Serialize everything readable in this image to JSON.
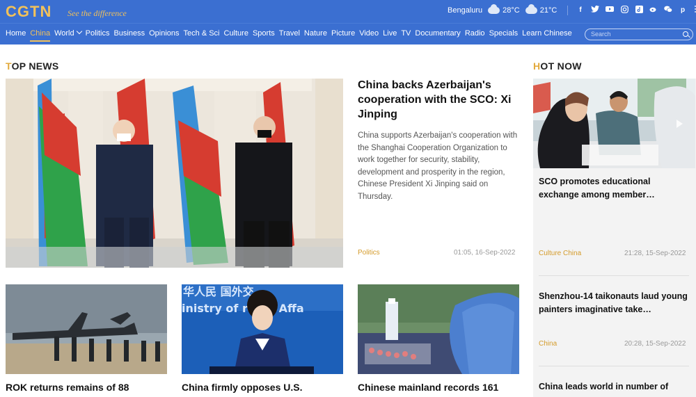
{
  "header": {
    "logo": "CGTN",
    "slogan": "See the difference",
    "city": "Bengaluru",
    "temp_high": "28°C",
    "temp_low": "21°C",
    "social_icons": [
      "facebook-icon",
      "twitter-icon",
      "youtube-icon",
      "instagram-icon",
      "tiktok-icon",
      "weibo-icon",
      "wechat-icon",
      "pinterest-icon",
      "more-icon"
    ]
  },
  "nav": {
    "items": [
      "Home",
      "China",
      "World",
      "Politics",
      "Business",
      "Opinions",
      "Tech & Sci",
      "Culture",
      "Sports",
      "Travel",
      "Nature",
      "Picture",
      "Video",
      "Live",
      "TV",
      "Documentary",
      "Radio",
      "Specials",
      "Learn Chinese"
    ],
    "active": "China",
    "search_placeholder": "Search"
  },
  "top_news": {
    "heading_first": "T",
    "heading_rest": "OP NEWS",
    "hero": {
      "title": "China backs Azerbaijan's cooperation with the SCO: Xi Jinping",
      "summary": "China supports Azerbaijan's cooperation with the Shanghai Cooperation Organization to work together for security, stability, development and prosperity in the region, Chinese President Xi Jinping said on Thursday.",
      "tag": "Politics",
      "time": "01:05, 16-Sep-2022"
    },
    "cards": [
      {
        "title": "ROK returns remains of 88"
      },
      {
        "title": "China firmly opposes U.S."
      },
      {
        "title": "Chinese mainland records 161"
      }
    ]
  },
  "hot_now": {
    "heading_first": "H",
    "heading_rest": "OT NOW",
    "items": [
      {
        "title": "SCO promotes educational exchange among member…",
        "tag": "Culture China",
        "time": "21:28, 15-Sep-2022"
      },
      {
        "title": "Shenzhou-14 taikonauts laud young painters imaginative take…",
        "tag": "China",
        "time": "20:28, 15-Sep-2022"
      },
      {
        "title": "China leads world in number of"
      }
    ]
  }
}
